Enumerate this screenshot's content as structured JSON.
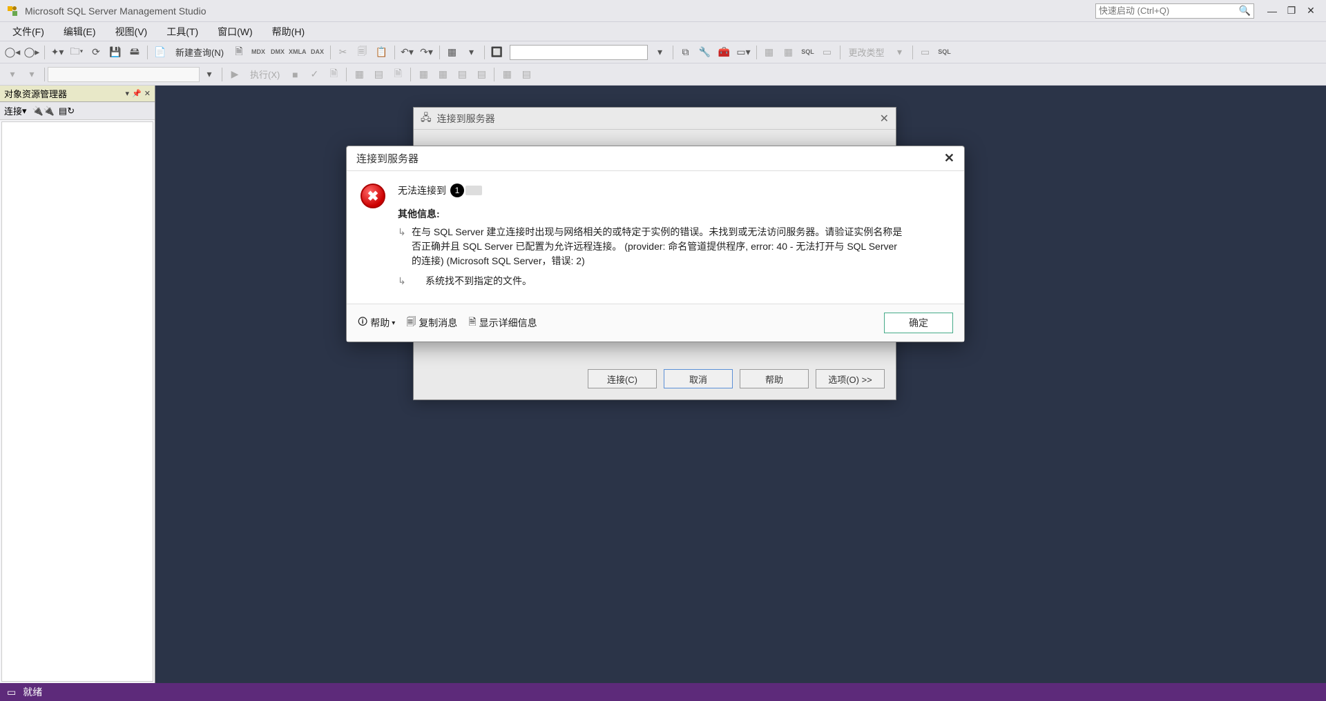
{
  "titlebar": {
    "app_title": "Microsoft SQL Server Management Studio",
    "quicklaunch_placeholder": "快速启动 (Ctrl+Q)"
  },
  "menu": {
    "file": "文件(F)",
    "edit": "编辑(E)",
    "view": "视图(V)",
    "tools": "工具(T)",
    "window": "窗口(W)",
    "help": "帮助(H)"
  },
  "toolbar": {
    "new_query": "新建查询(N)",
    "execute": "执行(X)",
    "change_type": "更改类型",
    "mdx": "MDX",
    "dmx": "DMX",
    "xmla": "XMLA",
    "dax": "DAX",
    "sql": "SQL"
  },
  "explorer": {
    "title": "对象资源管理器",
    "connect_label": "连接"
  },
  "bg_dialog": {
    "title": "连接到服务器",
    "btn_connect": "连接(C)",
    "btn_cancel": "取消",
    "btn_help": "帮助",
    "btn_options": "选项(O)  >>"
  },
  "err_dialog": {
    "title": "连接到服务器",
    "msg_prefix": "无法连接到",
    "badge_num": "1",
    "extra_label": "其他信息:",
    "detail1": "在与 SQL Server 建立连接时出现与网络相关的或特定于实例的错误。未找到或无法访问服务器。请验证实例名称是否正确并且 SQL Server 已配置为允许远程连接。 (provider: 命名管道提供程序, error: 40 - 无法打开与 SQL Server 的连接) (Microsoft SQL Server，错误: 2)",
    "detail2": "系统找不到指定的文件。",
    "help": "帮助",
    "copy": "复制消息",
    "show_details": "显示详细信息",
    "ok": "确定"
  },
  "statusbar": {
    "ready": "就绪"
  }
}
